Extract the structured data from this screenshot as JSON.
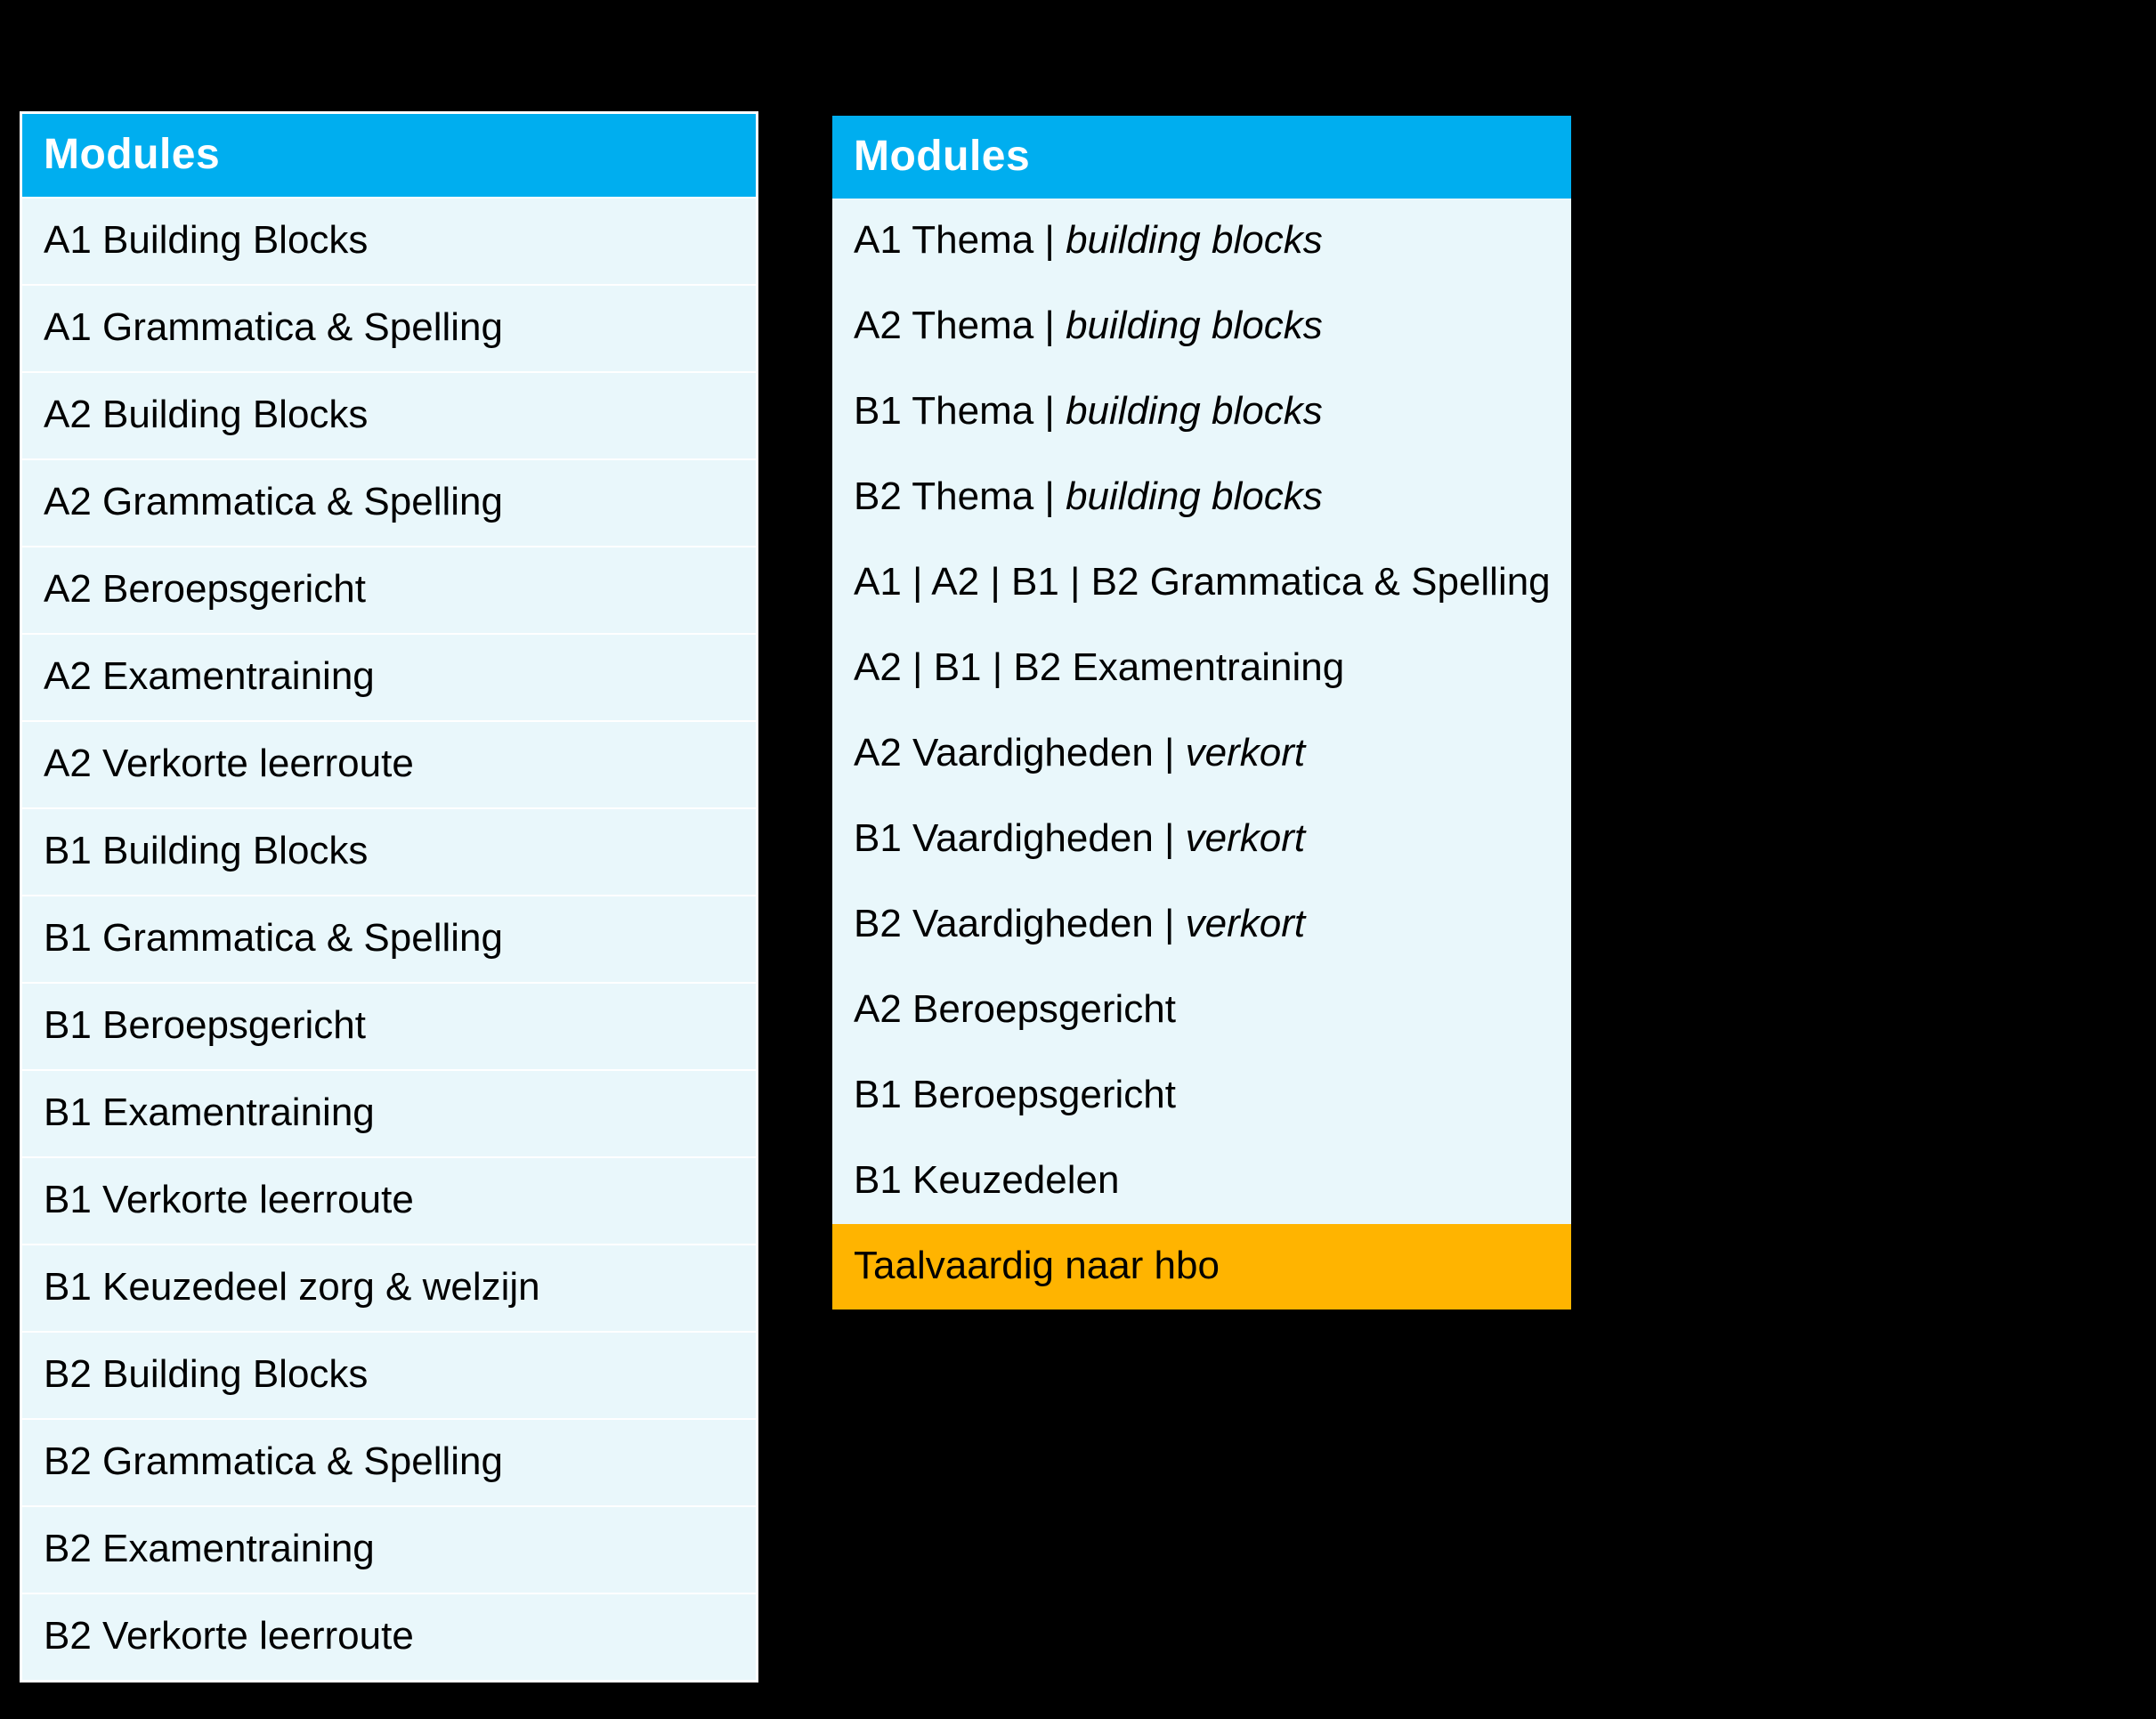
{
  "left": {
    "header": "Modules",
    "rows": [
      [
        {
          "t": "A1 Building Blocks"
        }
      ],
      [
        {
          "t": "A1 Grammatica & Spelling"
        }
      ],
      [
        {
          "t": "A2 Building Blocks"
        }
      ],
      [
        {
          "t": "A2 Grammatica & Spelling"
        }
      ],
      [
        {
          "t": "A2 Beroepsgericht"
        }
      ],
      [
        {
          "t": "A2 Examentraining"
        }
      ],
      [
        {
          "t": "A2 Verkorte leerroute"
        }
      ],
      [
        {
          "t": "B1 Building Blocks"
        }
      ],
      [
        {
          "t": "B1 Grammatica & Spelling"
        }
      ],
      [
        {
          "t": "B1 Beroepsgericht"
        }
      ],
      [
        {
          "t": "B1 Examentraining"
        }
      ],
      [
        {
          "t": "B1 Verkorte leerroute"
        }
      ],
      [
        {
          "t": "B1 Keuzedeel zorg & welzijn"
        }
      ],
      [
        {
          "t": "B2 Building Blocks"
        }
      ],
      [
        {
          "t": "B2 Grammatica & Spelling"
        }
      ],
      [
        {
          "t": "B2 Examentraining"
        }
      ],
      [
        {
          "t": "B2 Verkorte leerroute"
        }
      ]
    ]
  },
  "right": {
    "header": "Modules",
    "rows": [
      {
        "hl": false,
        "parts": [
          {
            "t": "A1 Thema | "
          },
          {
            "t": "building blocks",
            "i": true
          }
        ]
      },
      {
        "hl": false,
        "parts": [
          {
            "t": "A2 Thema | "
          },
          {
            "t": "building blocks",
            "i": true
          }
        ]
      },
      {
        "hl": false,
        "parts": [
          {
            "t": "B1 Thema | "
          },
          {
            "t": "building blocks",
            "i": true
          }
        ]
      },
      {
        "hl": false,
        "parts": [
          {
            "t": "B2 Thema | "
          },
          {
            "t": "building blocks",
            "i": true
          }
        ]
      },
      {
        "hl": false,
        "parts": [
          {
            "t": "A1 | A2 | B1 | B2 Grammatica & Spelling"
          }
        ]
      },
      {
        "hl": false,
        "parts": [
          {
            "t": "A2 | B1 | B2 Examentraining"
          }
        ]
      },
      {
        "hl": false,
        "parts": [
          {
            "t": "A2 Vaardigheden | "
          },
          {
            "t": "verkort",
            "i": true
          }
        ]
      },
      {
        "hl": false,
        "parts": [
          {
            "t": "B1 Vaardigheden | "
          },
          {
            "t": "verkort",
            "i": true
          }
        ]
      },
      {
        "hl": false,
        "parts": [
          {
            "t": "B2 Vaardigheden | "
          },
          {
            "t": "verkort",
            "i": true
          }
        ]
      },
      {
        "hl": false,
        "parts": [
          {
            "t": "A2 Beroepsgericht"
          }
        ]
      },
      {
        "hl": false,
        "parts": [
          {
            "t": "B1 Beroepsgericht"
          }
        ]
      },
      {
        "hl": false,
        "parts": [
          {
            "t": "B1 Keuzedelen"
          }
        ]
      },
      {
        "hl": true,
        "parts": [
          {
            "t": "Taalvaardig naar hbo"
          }
        ]
      }
    ]
  }
}
